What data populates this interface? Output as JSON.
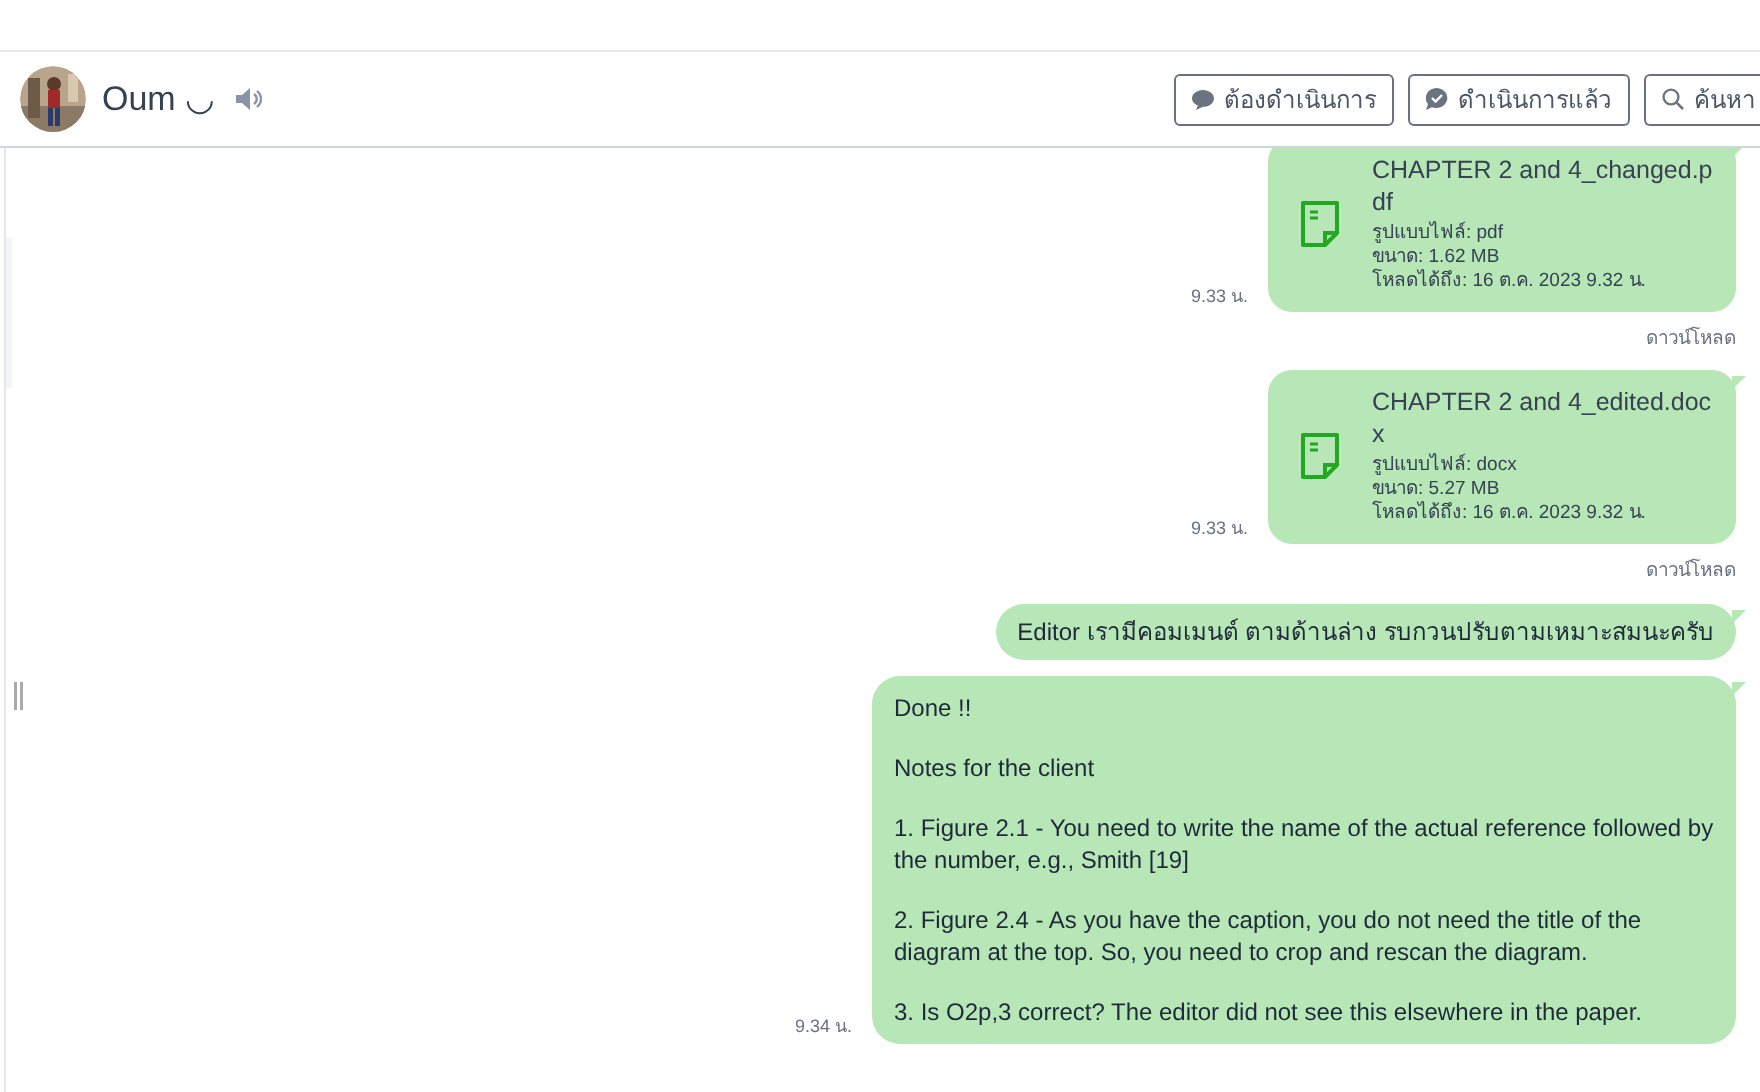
{
  "header": {
    "name": "Oum ◡",
    "buttons": [
      {
        "label": "ต้องดำเนินการ",
        "kind": "pending"
      },
      {
        "label": "ดำเนินการแล้ว",
        "kind": "done"
      },
      {
        "label": "ค้นหา",
        "kind": "search"
      }
    ]
  },
  "messages": [
    {
      "kind": "file",
      "filename": "CHAPTER 2 and 4_changed.p\ndf",
      "details": [
        "รูปแบบไฟล์: pdf",
        "ขนาด: 1.62 MB",
        "โหลดได้ถึง: 16 ต.ค. 2023 9.32 น."
      ],
      "time": "9.33 น.",
      "download": "ดาวน์โหลด"
    },
    {
      "kind": "file",
      "filename": "CHAPTER 2 and 4_edited.doc\nx",
      "details": [
        "รูปแบบไฟล์: docx",
        "ขนาด: 5.27 MB",
        "โหลดได้ถึง: 16 ต.ค. 2023 9.32 น."
      ],
      "time": "9.33 น.",
      "download": "ดาวน์โหลด"
    },
    {
      "kind": "text",
      "paragraphs": [
        "Editor เรามีคอมเมนต์ ตามด้านล่าง รบกวนปรับตามเหมาะสมนะครับ"
      ]
    },
    {
      "kind": "text",
      "paragraphs": [
        "Done !!",
        "Notes for the client",
        "1. Figure 2.1 - You need to write the name of the actual reference followed by the number, e.g., Smith [19]",
        "2. Figure 2.4 - As you have the caption, you do not need the title of the diagram at the top. So, you need to crop and rescan the diagram.",
        "3. Is O2p,3 correct? The editor did not see this elsewhere in the paper."
      ],
      "time": "9.34 น."
    }
  ]
}
